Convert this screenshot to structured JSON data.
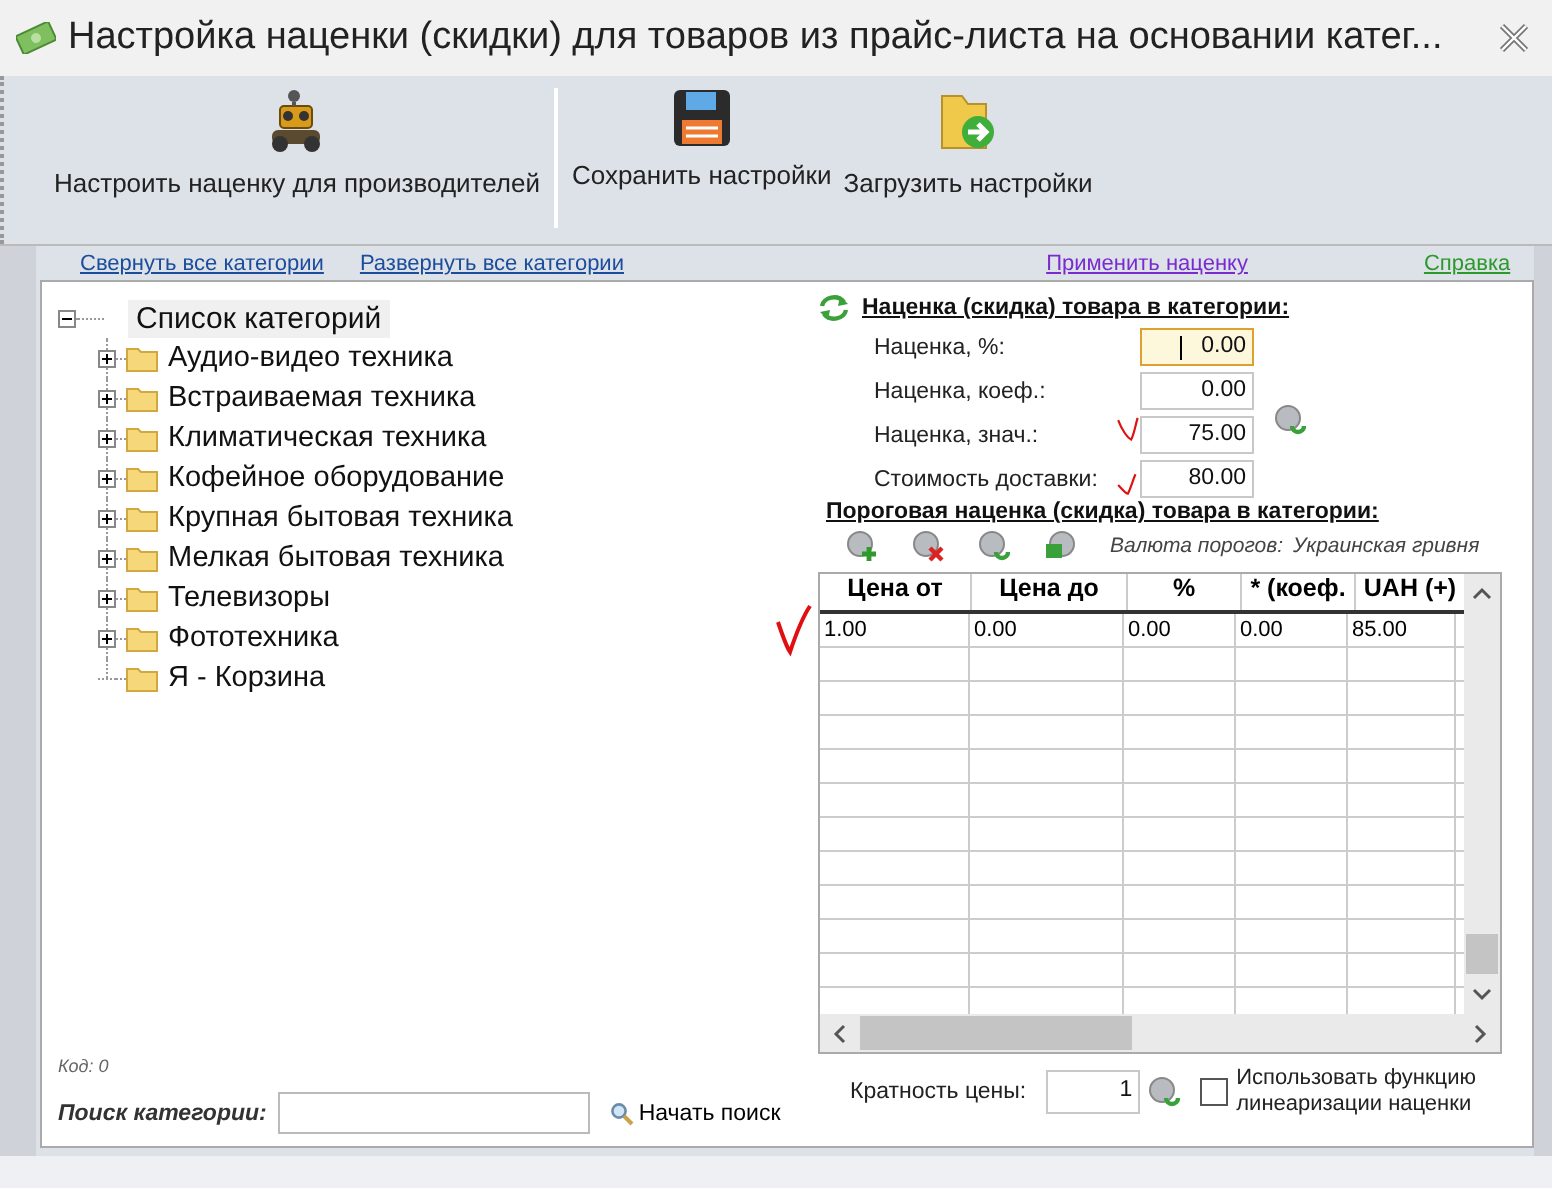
{
  "window": {
    "title": "Настройка наценки (скидки) для товаров из прайс-листа на основании катег..."
  },
  "toolbar": [
    {
      "label": "Настроить наценку для производителей",
      "kind": "robot"
    },
    {
      "label": "Сохранить настройки",
      "kind": "floppy"
    },
    {
      "label": "Загрузить настройки",
      "kind": "folder"
    }
  ],
  "links": {
    "collapse_all": "Свернуть все категории",
    "expand_all": "Развернуть все категории",
    "apply": "Применить наценку",
    "help": "Справка"
  },
  "tree": {
    "label": "Список категорий",
    "expanded": true,
    "children": [
      {
        "label": "Аудио-видео техника",
        "expandable": true
      },
      {
        "label": "Встраиваемая техника",
        "expandable": true
      },
      {
        "label": "Климатическая техника",
        "expandable": true
      },
      {
        "label": "Кофейное оборудование",
        "expandable": true
      },
      {
        "label": "Крупная бытовая техника",
        "expandable": true
      },
      {
        "label": "Мелкая бытовая техника",
        "expandable": true
      },
      {
        "label": "Телевизоры",
        "expandable": true
      },
      {
        "label": "Фототехника",
        "expandable": true
      },
      {
        "label": "Я - Корзина",
        "expandable": false
      }
    ]
  },
  "code_label": "Код: 0",
  "search": {
    "label": "Поиск категории:",
    "button": "Начать поиск"
  },
  "markup": {
    "title": "Наценка (скидка) товара в категории:",
    "fields": [
      {
        "label": "Наценка, %:",
        "value": "0.00",
        "focused": true
      },
      {
        "label": "Наценка, коеф.:",
        "value": "0.00",
        "focused": false
      },
      {
        "label": "Наценка, знач.:",
        "value": "75.00",
        "focused": false
      },
      {
        "label": "Стоимость доставки:",
        "value": "80.00",
        "focused": false
      }
    ]
  },
  "threshold": {
    "title": "Пороговая наценка (скидка) товара в категории:",
    "currency_label": "Валюта порогов:",
    "currency": "Украинская гривня",
    "columns": [
      "Цена от",
      "Цена до",
      "%",
      "* (коеф.",
      "UAH (+)"
    ],
    "rows": [
      [
        "1.00",
        "0.00",
        "0.00",
        "0.00",
        "85.00"
      ]
    ]
  },
  "multiplicity": {
    "label": "Кратность цены:",
    "value": "1"
  },
  "linearize": {
    "label": "Использовать функцию линеаризации наценки",
    "checked": false
  }
}
